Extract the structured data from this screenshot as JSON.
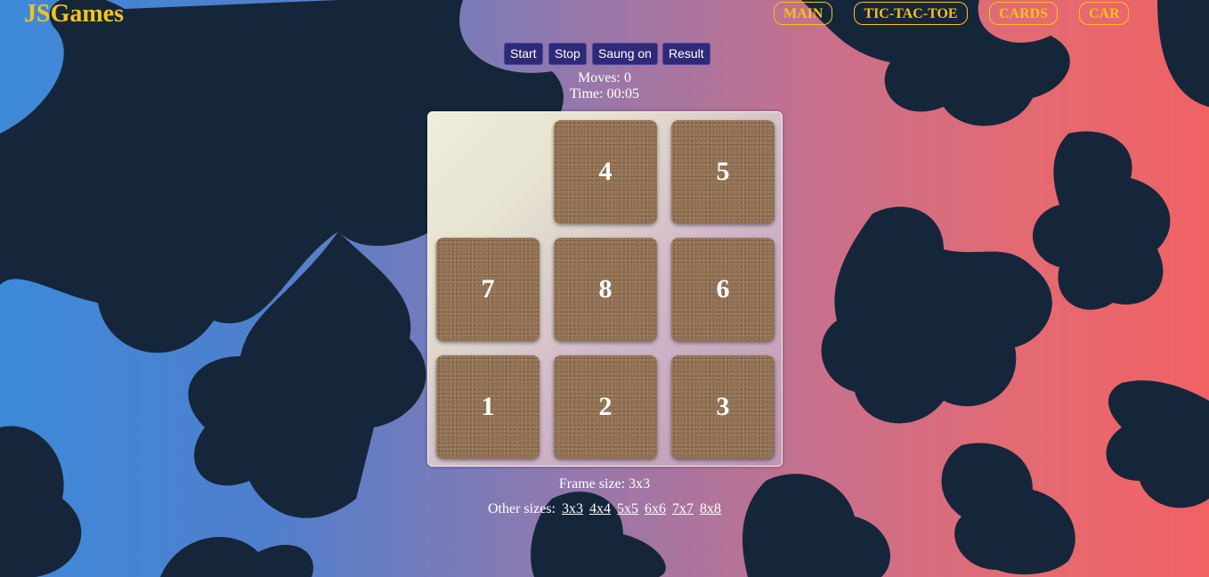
{
  "header": {
    "logo": "JSGames",
    "nav": [
      "MAIN",
      "TIC-TAC-TOE",
      "CARDS",
      "CAR"
    ]
  },
  "controls": {
    "start": "Start",
    "stop": "Stop",
    "sound": "Saung on",
    "result": "Result"
  },
  "stats": {
    "moves": "Moves: 0",
    "time": "Time: 00:05"
  },
  "board": {
    "size": 3,
    "tiles": [
      "",
      "4",
      "5",
      "7",
      "8",
      "6",
      "1",
      "2",
      "3"
    ]
  },
  "footer": {
    "frame_size": "Frame size: 3x3",
    "other_sizes_label": "Other sizes:",
    "other_sizes": [
      "3x3",
      "4x4",
      "5x5",
      "6x6",
      "7x7",
      "8x8"
    ]
  },
  "colors": {
    "accent": "#f6c21b",
    "button_bg": "#2f2a78",
    "tile": "#8e6c4c"
  }
}
